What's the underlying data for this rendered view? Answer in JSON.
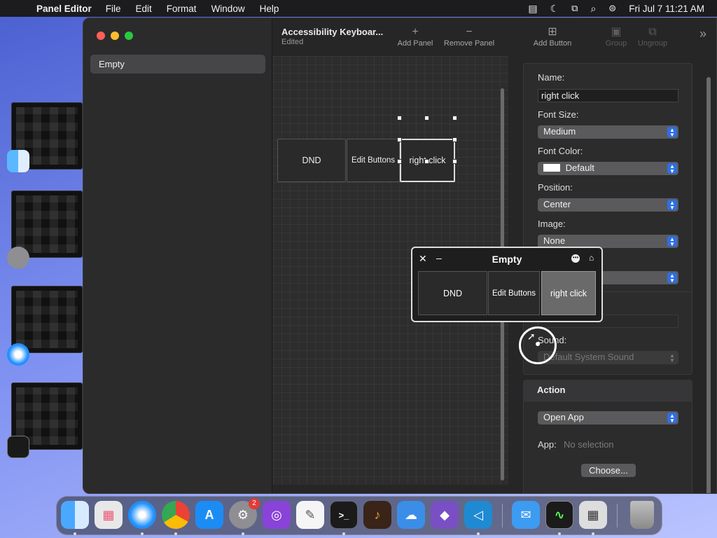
{
  "menubar": {
    "app": "Panel Editor",
    "items": [
      "File",
      "Edit",
      "Format",
      "Window",
      "Help"
    ],
    "clock": "Fri Jul 7  11:21 AM"
  },
  "sidebar": {
    "items": [
      {
        "label": "Empty"
      }
    ]
  },
  "toolbar": {
    "title": "Accessibility Keyboar...",
    "subtitle": "Edited",
    "add_panel": "Add Panel",
    "remove_panel": "Remove Panel",
    "add_button": "Add Button",
    "group": "Group",
    "ungroup": "Ungroup"
  },
  "canvas": {
    "buttons": [
      "DND",
      "Edit Buttons",
      "right click"
    ]
  },
  "inspector": {
    "name_label": "Name:",
    "name_value": "right click",
    "font_size_label": "Font Size:",
    "font_size_value": "Medium",
    "font_color_label": "Font Color:",
    "font_color_value": "Default",
    "position_label": "Position:",
    "position_value": "Center",
    "image_label": "Image:",
    "image_value": "None",
    "sound_label": "Sound:",
    "sound_value": "Default System Sound",
    "action_header": "Action",
    "action_value": "Open App",
    "app_label": "App:",
    "app_value": "No selection",
    "choose_label": "Choose..."
  },
  "floating_panel": {
    "title": "Empty",
    "buttons": [
      "DND",
      "Edit Buttons",
      "right click"
    ]
  },
  "dock": {
    "apps": [
      "Finder",
      "Launchpad",
      "Safari",
      "Chrome",
      "App Store",
      "System Settings",
      "Podcasts",
      "TextEdit",
      "Terminal",
      "GarageBand",
      "Weather",
      "Visual Studio",
      "VS Code",
      "Mail",
      "Activity Monitor",
      "Panel Editor",
      "Trash"
    ],
    "settings_badge": "2"
  },
  "colors": {
    "accent": "#2f6fe0",
    "window_bg": "#262626",
    "desktop": "#7d8ff0"
  }
}
